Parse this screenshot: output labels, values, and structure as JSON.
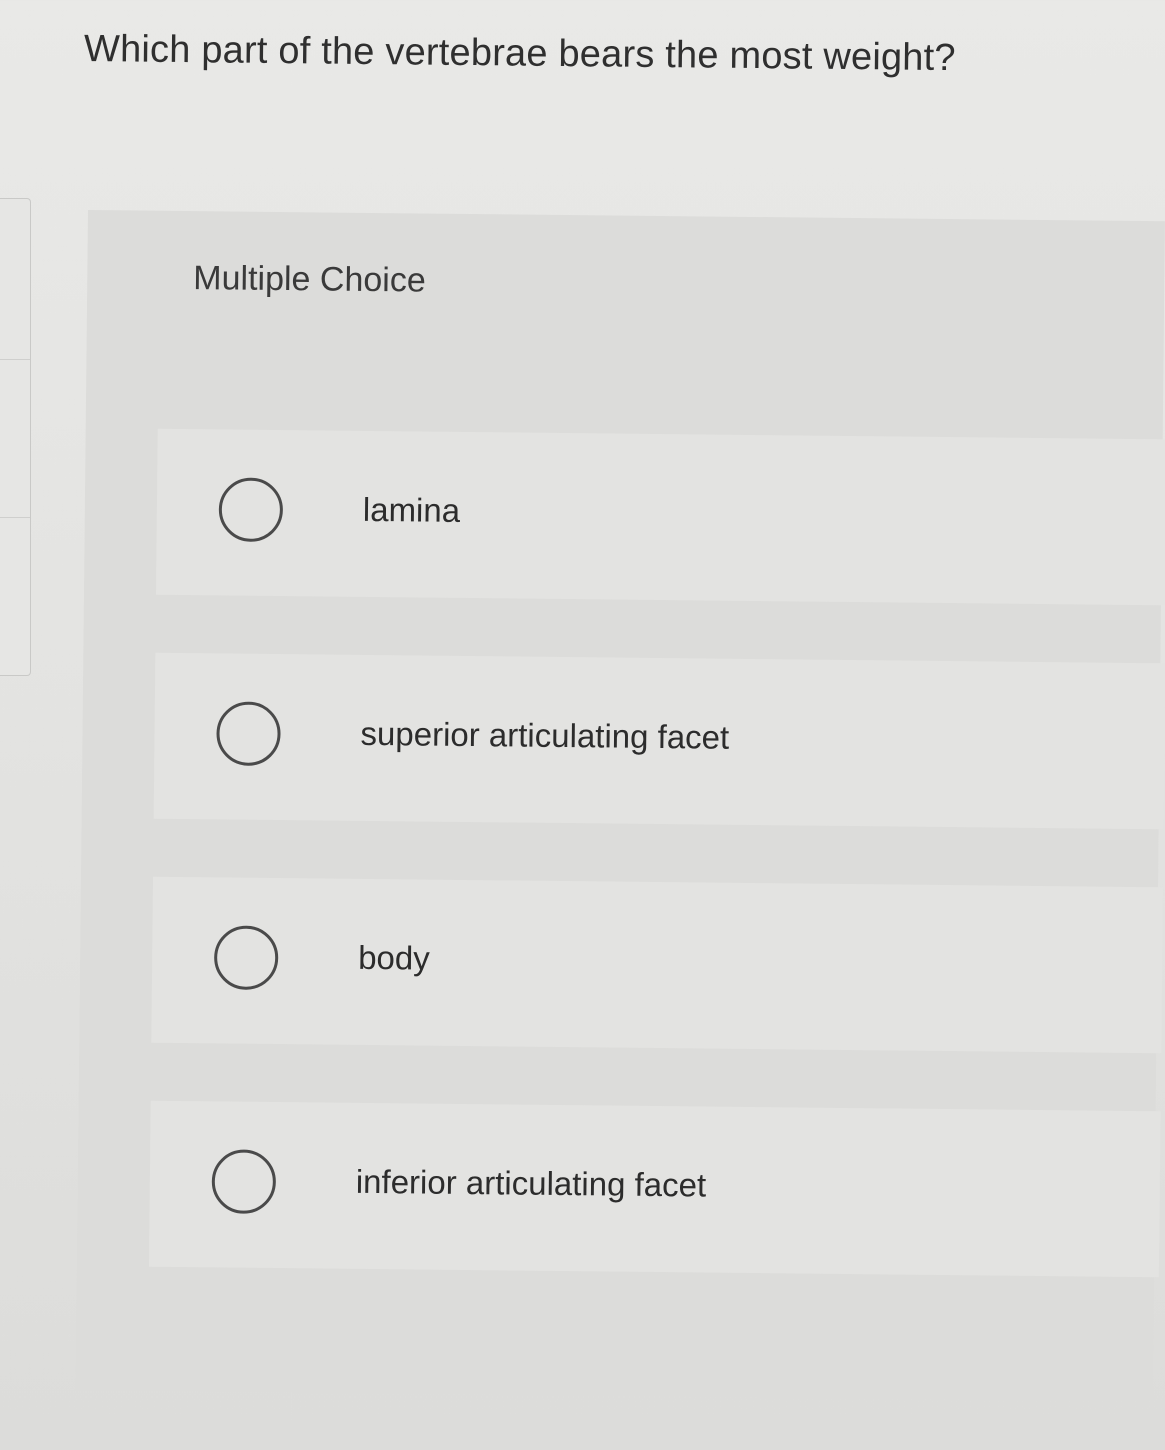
{
  "question": {
    "text": "Which part of the vertebrae bears the most weight?"
  },
  "question_type": {
    "label": "Multiple Choice"
  },
  "options": [
    {
      "label": "lamina",
      "selected": false
    },
    {
      "label": "superior articulating facet",
      "selected": false
    },
    {
      "label": "body",
      "selected": false
    },
    {
      "label": "inferior articulating facet",
      "selected": false
    }
  ]
}
